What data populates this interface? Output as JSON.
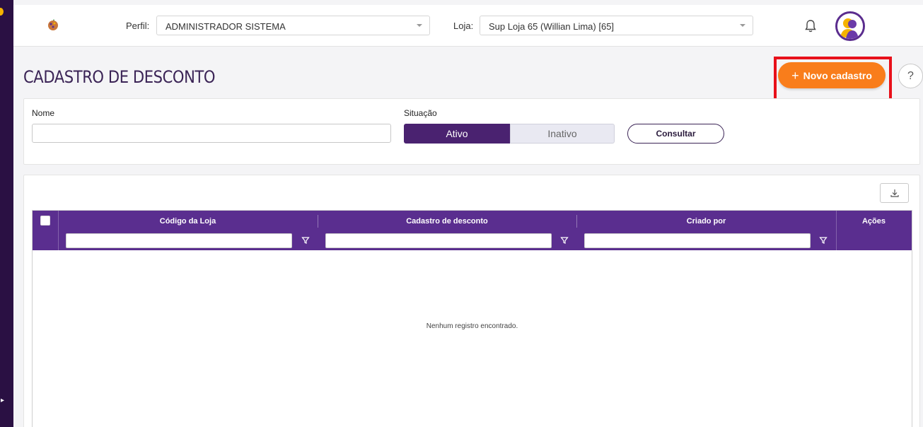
{
  "header": {
    "profile_label": "Perfil",
    "profile_value": "ADMINISTRADOR SISTEMA",
    "store_label": "Loja",
    "store_value": "Sup Loja 65 (Willian Lima) [65]"
  },
  "page": {
    "title": "CADASTRO DE DESCONTO",
    "new_button_label": "Novo cadastro",
    "help_label": "?"
  },
  "filters": {
    "name_label": "Nome",
    "name_value": "",
    "status_label": "Situação",
    "status_options": [
      "Ativo",
      "Inativo"
    ],
    "status_selected": "Ativo",
    "search_button": "Consultar"
  },
  "grid": {
    "columns": [
      "Código da Loja",
      "Cadastro de desconto",
      "Criado por",
      "Ações"
    ],
    "rows": [],
    "empty_message": "Nenhum registro encontrado."
  },
  "colors": {
    "brand_purple": "#5a2e8f",
    "dark_purple": "#4a2270",
    "accent_orange": "#f97d1b",
    "highlight_red": "#e8101a"
  }
}
